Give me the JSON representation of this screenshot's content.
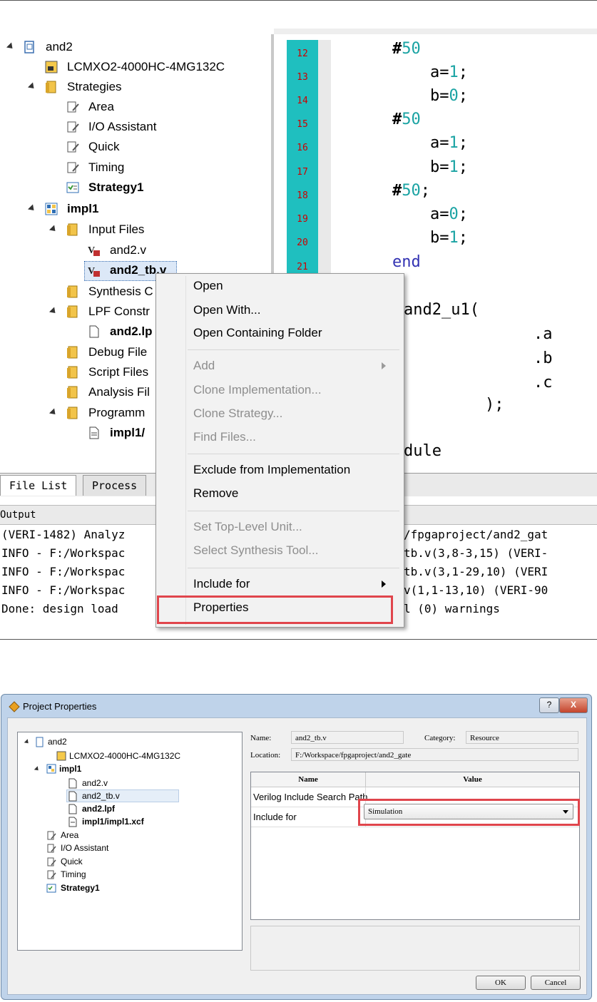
{
  "top": {
    "tree": {
      "root": "and2",
      "device": "LCMXO2-4000HC-4MG132C",
      "strategies_folder": "Strategies",
      "strategies": [
        "Area",
        "I/O Assistant",
        "Quick",
        "Timing",
        "Strategy1"
      ],
      "impl": "impl1",
      "input_files_folder": "Input Files",
      "input_files": [
        "and2.v",
        "and2_tb.v"
      ],
      "synthesis": "Synthesis C",
      "lpf_folder": "LPF Constr",
      "lpf_file": "and2.lp",
      "debug": "Debug File",
      "script": "Script Files",
      "analysis": "Analysis Fil",
      "programming": "Programm",
      "programming_file": "impl1/"
    },
    "code": {
      "line_numbers": [
        "12",
        "13",
        "14",
        "15",
        "16",
        "17",
        "18",
        "19",
        "20",
        "21"
      ],
      "lines": [
        {
          "pre": "#",
          "num": "50",
          "post": ""
        },
        {
          "pre": "    a=",
          "num": "1",
          "post": ";"
        },
        {
          "pre": "    b=",
          "num": "0",
          "post": ";"
        },
        {
          "pre": "#",
          "num": "50",
          "post": ""
        },
        {
          "pre": "    a=",
          "num": "1",
          "post": ";"
        },
        {
          "pre": "    b=",
          "num": "1",
          "post": ";"
        },
        {
          "pre": "#",
          "num": "50",
          "post": ";"
        },
        {
          "pre": "    a=",
          "num": "0",
          "post": ";"
        },
        {
          "pre": "    b=",
          "num": "1",
          "post": ";"
        },
        {
          "pre": "",
          "num": "",
          "post": "end"
        }
      ],
      "extra": [
        "and2_u1(",
        ".a",
        ".b",
        ".c",
        ");",
        "dule"
      ]
    },
    "tabs": [
      "File List",
      "Process"
    ],
    "output_title": "Output",
    "output_left": [
      "(VERI-1482) Analyz",
      "INFO - F:/Workspac",
      "INFO - F:/Workspac",
      "INFO - F:/Workspac",
      "Done: design load"
    ],
    "output_right": [
      "/fpgaproject/and2_gat",
      "tb.v(3,8-3,15) (VERI-",
      "tb.v(3,1-29,10) (VERI",
      "v(1,1-13,10) (VERI-90",
      "l (0) warnings"
    ],
    "context_menu": {
      "open": "Open",
      "open_with": "Open With...",
      "open_folder": "Open Containing Folder",
      "add": "Add",
      "clone_impl": "Clone Implementation...",
      "clone_strategy": "Clone Strategy...",
      "find_files": "Find Files...",
      "exclude": "Exclude from Implementation",
      "remove": "Remove",
      "set_top": "Set Top-Level Unit...",
      "select_synth": "Select Synthesis Tool...",
      "include_for": "Include for",
      "properties": "Properties"
    }
  },
  "dialog": {
    "title": "Project Properties",
    "help_btn": "?",
    "close_btn": "X",
    "tree": {
      "root": "and2",
      "device": "LCMXO2-4000HC-4MG132C",
      "impl": "impl1",
      "files": [
        "and2.v",
        "and2_tb.v",
        "and2.lpf",
        "impl1/impl1.xcf"
      ],
      "strategies": [
        "Area",
        "I/O Assistant",
        "Quick",
        "Timing",
        "Strategy1"
      ]
    },
    "name_label": "Name:",
    "name_value": "and2_tb.v",
    "category_label": "Category:",
    "category_value": "Resource",
    "location_label": "Location:",
    "location_value": "F:/Workspace/fpgaproject/and2_gate",
    "grid_headers": [
      "Name",
      "Value"
    ],
    "rows": [
      {
        "name": "Verilog Include Search Path",
        "value": ""
      },
      {
        "name": "Include for",
        "value": "Simulation"
      }
    ],
    "ok": "OK",
    "cancel": "Cancel"
  },
  "colors": {
    "gutter": "#1fbfbf",
    "line_number": "#cc0000",
    "highlight_box": "#e0454c",
    "dialog_frame": "#bfd3ea"
  }
}
